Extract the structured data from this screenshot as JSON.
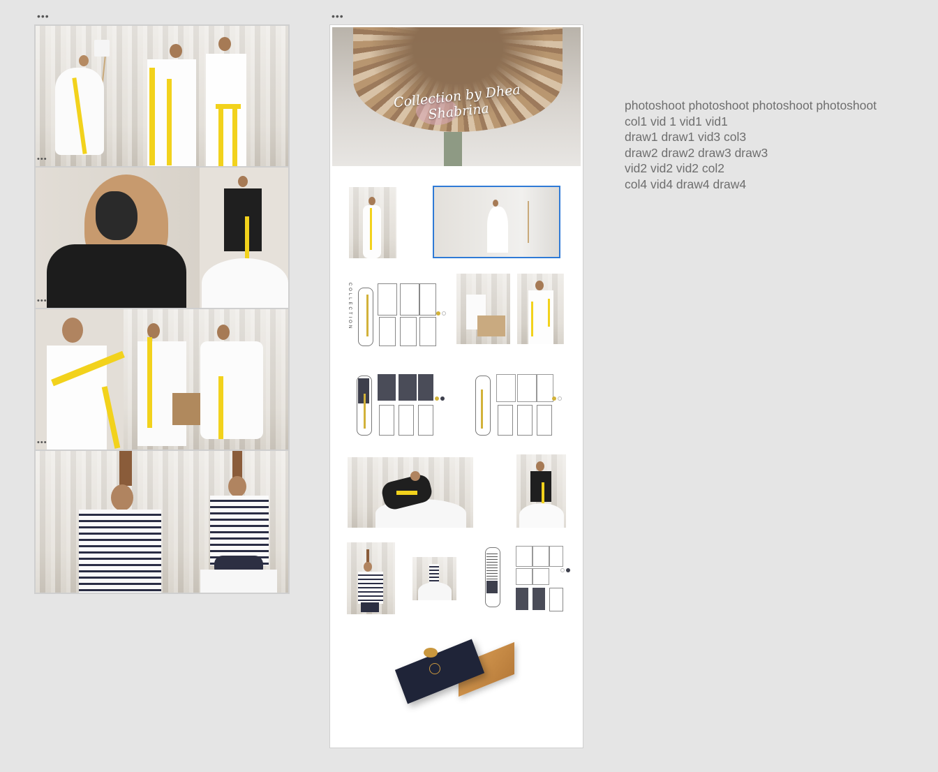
{
  "frames": {
    "left_menu_icon": "more-dots",
    "right_menu_icon": "more-dots"
  },
  "banner": {
    "script_text": "Collection by Dhea Shabrina"
  },
  "labels": [
    "photoshoot photoshoot photoshoot photoshoot",
    "col1 vid 1 vid1 vid1",
    "draw1 draw1 vid3 col3",
    "draw2 draw2 draw3 draw3",
    "vid2 vid2 vid2 col2",
    "col4 vid4 draw4 draw4"
  ],
  "sketch_caption": "COLLECTION",
  "colors": {
    "background": "#e5e5e5",
    "selection": "#2f7ad6",
    "ribbon": "#f2d21c"
  }
}
